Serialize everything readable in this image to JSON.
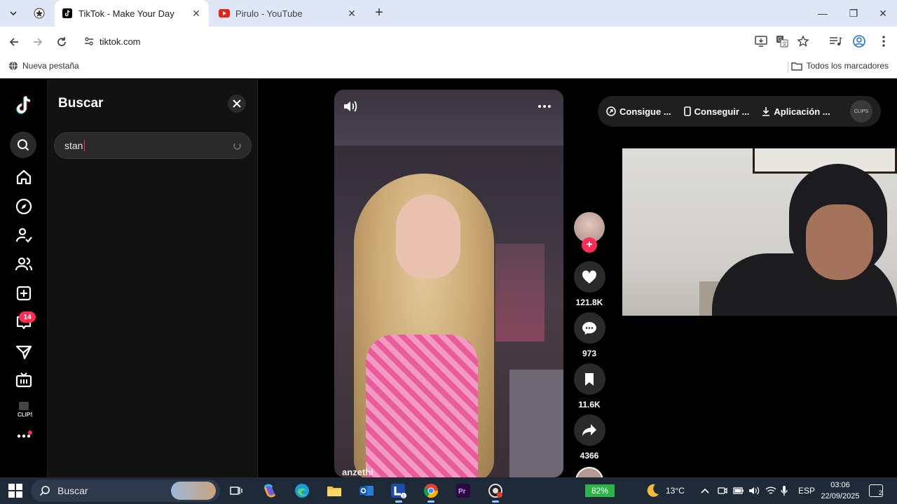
{
  "browser": {
    "tabs": [
      {
        "title": "TikTok - Make Your Day",
        "active": true
      },
      {
        "title": "Pirulo - YouTube",
        "active": false
      }
    ],
    "url": "tiktok.com",
    "bookmarks": {
      "left": "Nueva pestaña",
      "right": "Todos los marcadores"
    }
  },
  "sidebar": {
    "notifications_badge": "14",
    "items": [
      {
        "icon": "tiktok-logo-icon"
      },
      {
        "icon": "search-icon"
      },
      {
        "icon": "home-icon"
      },
      {
        "icon": "explore-icon"
      },
      {
        "icon": "following-icon"
      },
      {
        "icon": "friends-icon"
      },
      {
        "icon": "upload-icon"
      },
      {
        "icon": "activity-icon"
      },
      {
        "icon": "messages-icon"
      },
      {
        "icon": "live-icon"
      },
      {
        "icon": "clips-icon",
        "label": "CLIPS"
      },
      {
        "icon": "more-icon"
      }
    ]
  },
  "search_panel": {
    "title": "Buscar",
    "query": "stan"
  },
  "video": {
    "username": "anzethi",
    "likes": "121.8K",
    "comments": "973",
    "saves": "11.6K",
    "shares": "4366"
  },
  "top_actions": [
    {
      "label": "Consigue ...",
      "icon": "coin-icon"
    },
    {
      "label": "Conseguir ...",
      "icon": "phone-icon"
    },
    {
      "label": "Aplicación ...",
      "icon": "download-icon"
    }
  ],
  "top_clips_label": "CLIPS",
  "taskbar": {
    "search_placeholder": "Buscar",
    "battery": "82%",
    "temperature": "13°C",
    "language": "ESP",
    "time": "03:06",
    "date": "22/09/2025",
    "notif_count": "2"
  },
  "colors": {
    "accent": "#fe2c55",
    "page_bg": "#000000",
    "panel_bg": "#121212",
    "taskbar_bg": "#1f2a38"
  }
}
